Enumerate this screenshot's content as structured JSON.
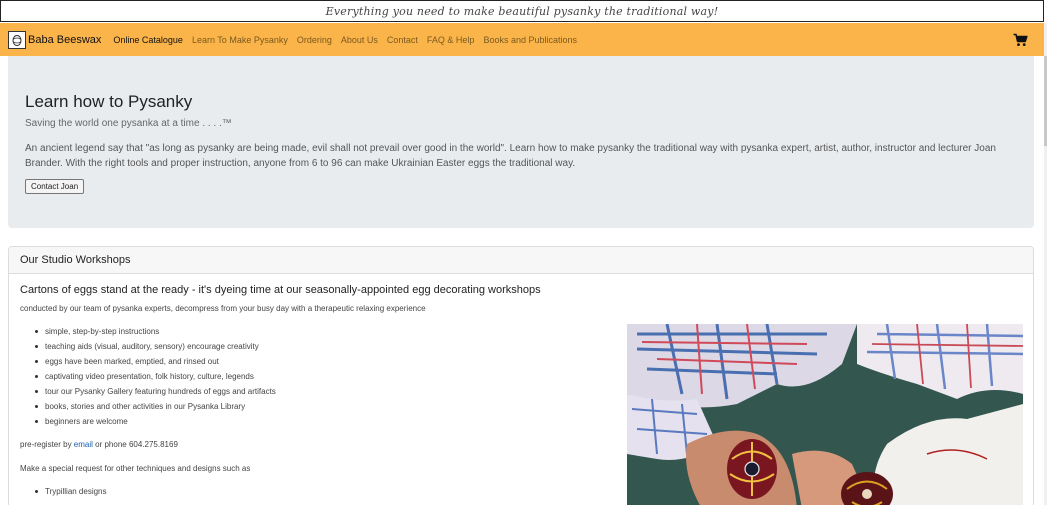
{
  "banner": {
    "text": "Everything you need to make beautiful pysanky the traditional way!"
  },
  "nav": {
    "brand": "Baba Beeswax",
    "links": [
      "Online Catalogue",
      "Learn To Make Pysanky",
      "Ordering",
      "About Us",
      "Contact",
      "FAQ & Help",
      "Books and Publications"
    ],
    "active_index": 0,
    "cart_icon": "shopping-cart-icon",
    "bg_color": "#fbb44a"
  },
  "hero": {
    "title": "Learn how to Pysanky",
    "tagline": "Saving the world one pysanka at a time . . . .™",
    "text": "An ancient legend say that \"as long as pysanky are being made, evil shall not prevail over good in the world\". Learn how to make pysanky the traditional way with pysanka expert, artist, author, instructor and lecturer Joan Brander. With the right tools and proper instruction, anyone from 6 to 96 can make Ukrainian Easter eggs the traditional way.",
    "button": "Contact Joan"
  },
  "workshops": {
    "header": "Our Studio Workshops",
    "heading": "Cartons of eggs stand at the ready - it's dyeing time at our seasonally-appointed egg decorating workshops",
    "sub": "conducted by our team of pysanka experts, decompress from your busy day with a therapeutic relaxing experience",
    "items": [
      "simple, step-by-step instructions",
      "teaching aids (visual, auditory, sensory) encourage creativity",
      "eggs have been marked, emptied, and rinsed out",
      "captivating video presentation, folk history, culture, legends",
      "tour our Pysanky Gallery featuring hundreds of eggs and artifacts",
      "books, stories and other activities in our Pysanka Library",
      "beginners are welcome"
    ],
    "prereg_prefix": "pre-register by ",
    "prereg_link": "email",
    "prereg_suffix": " or phone 604.275.8169",
    "special": "Make a special request for other techniques and designs such as",
    "special_items": [
      "Trypillian designs"
    ]
  }
}
